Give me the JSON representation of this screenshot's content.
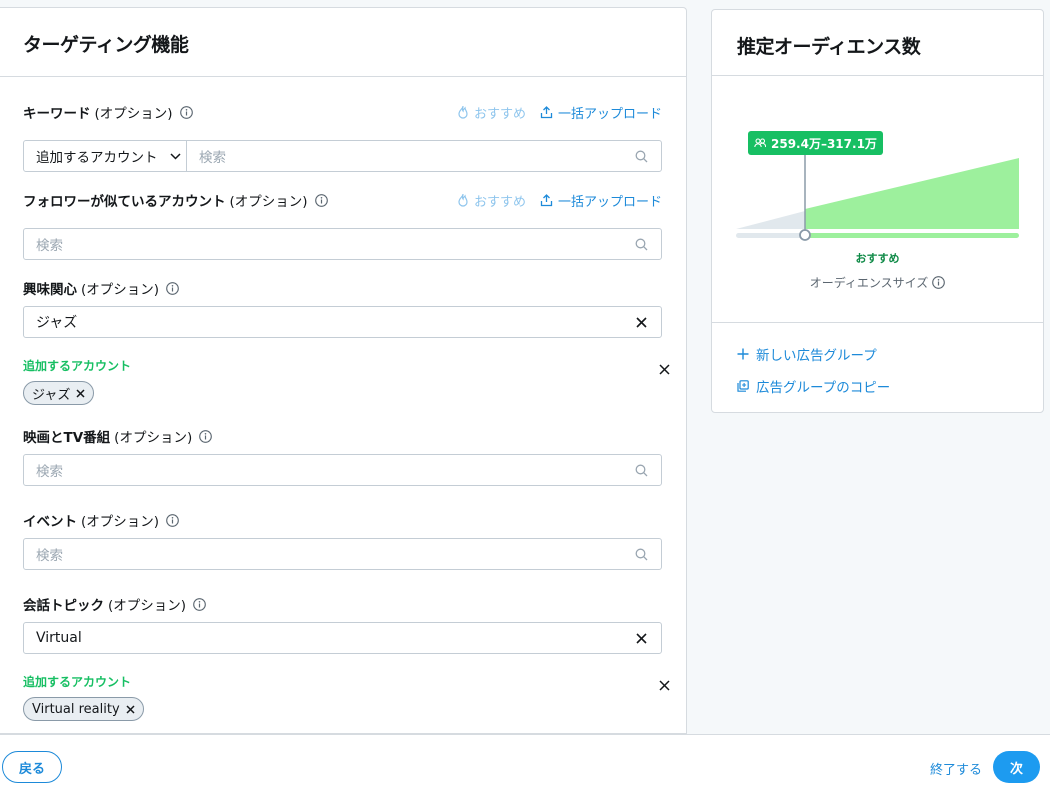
{
  "targeting": {
    "title": "ターゲティング機能",
    "recommend_label": "おすすめ",
    "bulk_upload_label": "一括アップロード",
    "search_placeholder": "検索",
    "optional_label": "(オプション)",
    "keywords": {
      "label": "キーワード",
      "select_value": "追加するアカウント"
    },
    "follower_lookalikes": {
      "label": "フォロワーが似ているアカウント"
    },
    "interests": {
      "label": "興味関心",
      "value": "ジャズ",
      "added_label": "追加するアカウント",
      "chips": [
        "ジャズ"
      ]
    },
    "movies_tv": {
      "label": "映画とTV番組"
    },
    "events": {
      "label": "イベント"
    },
    "conversation_topics": {
      "label": "会話トピック",
      "value": "Virtual",
      "added_label": "追加するアカウント",
      "chips": [
        "Virtual reality"
      ]
    }
  },
  "audience": {
    "title": "推定オーディエンス数",
    "range": "259.4万–317.1万",
    "recommend_label": "おすすめ",
    "size_label": "オーディエンスサイズ",
    "new_ad_group": "新しい広告グループ",
    "copy_ad_group": "広告グループのコピー"
  },
  "footer": {
    "back": "戻る",
    "exit": "終了する",
    "next": "次"
  },
  "colors": {
    "accent_blue": "#1d8ad9",
    "green": "#17bf63",
    "light_green": "#9df09d"
  }
}
